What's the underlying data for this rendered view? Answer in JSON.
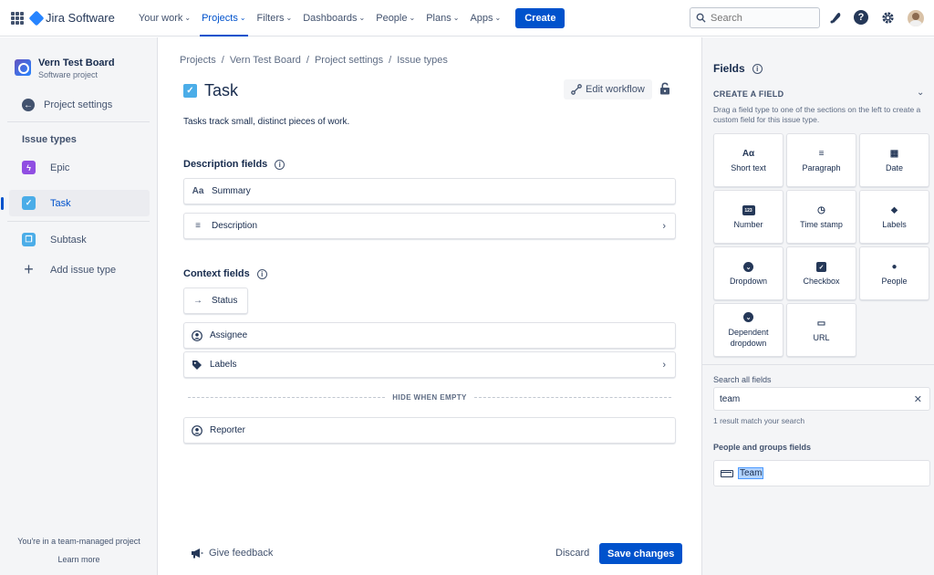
{
  "topnav": {
    "app_name": "Jira Software",
    "items": [
      {
        "label": "Your work",
        "active": false
      },
      {
        "label": "Projects",
        "active": true
      },
      {
        "label": "Filters",
        "active": false
      },
      {
        "label": "Dashboards",
        "active": false
      },
      {
        "label": "People",
        "active": false
      },
      {
        "label": "Plans",
        "active": false
      },
      {
        "label": "Apps",
        "active": false
      }
    ],
    "create_label": "Create",
    "search_placeholder": "Search"
  },
  "sidebar": {
    "project_name": "Vern Test Board",
    "project_type": "Software project",
    "back_label": "Project settings",
    "heading": "Issue types",
    "items": [
      {
        "label": "Epic",
        "icon": "epic-icon"
      },
      {
        "label": "Task",
        "icon": "task-icon"
      },
      {
        "label": "Subtask",
        "icon": "subtask-icon"
      }
    ],
    "add_label": "Add issue type",
    "footer_text": "You're in a team-managed project",
    "learn_more": "Learn more"
  },
  "main": {
    "breadcrumbs": [
      "Projects",
      "Vern Test Board",
      "Project settings",
      "Issue types"
    ],
    "title": "Task",
    "edit_workflow": "Edit workflow",
    "description": "Tasks track small, distinct pieces of work.",
    "description_fields_heading": "Description fields",
    "description_fields": [
      {
        "label": "Summary",
        "icon": "Aa"
      },
      {
        "label": "Description",
        "icon": "≡"
      }
    ],
    "context_fields_heading": "Context fields",
    "context_fields": [
      {
        "label": "Status"
      },
      {
        "label": "Assignee"
      },
      {
        "label": "Labels"
      }
    ],
    "hide_when_empty": "HIDE WHEN EMPTY",
    "hidden_fields": [
      {
        "label": "Reporter"
      }
    ],
    "give_feedback": "Give feedback",
    "discard": "Discard",
    "save": "Save changes"
  },
  "rpanel": {
    "title": "Fields",
    "create_field": "CREATE A FIELD",
    "create_desc": "Drag a field type to one of the sections on the left to create a custom field for this issue type.",
    "tiles": [
      {
        "label": "Short text",
        "glyph": "Aα"
      },
      {
        "label": "Paragraph",
        "glyph": "≡"
      },
      {
        "label": "Date",
        "glyph": "▦"
      },
      {
        "label": "Number",
        "glyph": "123"
      },
      {
        "label": "Time stamp",
        "glyph": "◷"
      },
      {
        "label": "Labels",
        "glyph": "⬥"
      },
      {
        "label": "Dropdown",
        "glyph": "⌄"
      },
      {
        "label": "Checkbox",
        "glyph": "✓"
      },
      {
        "label": "People",
        "glyph": "●"
      },
      {
        "label": "Dependent\ndropdown",
        "glyph": "⌄"
      },
      {
        "label": "URL",
        "glyph": "▭"
      }
    ],
    "search_label": "Search all fields",
    "search_value": "team",
    "result_text": "1 result match your search",
    "group_heading": "People and groups fields",
    "result_item": "Team"
  }
}
